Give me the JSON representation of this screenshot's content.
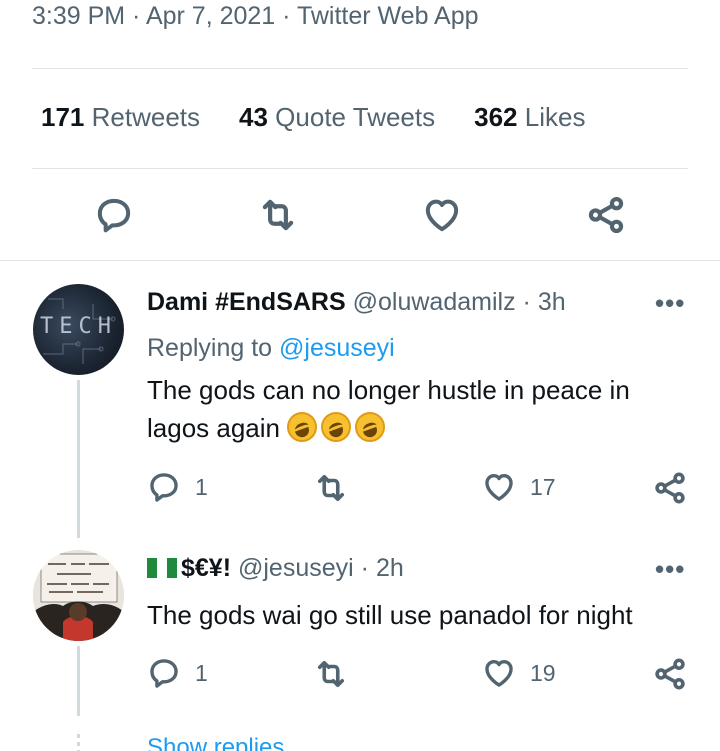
{
  "tweet": {
    "meta": "3:39 PM · Apr 7, 2021 · Twitter Web App",
    "stats": [
      {
        "count": "171",
        "label": "Retweets"
      },
      {
        "count": "43",
        "label": "Quote Tweets"
      },
      {
        "count": "362",
        "label": "Likes"
      }
    ],
    "actions": [
      "reply-icon",
      "retweet-icon",
      "like-icon",
      "share-icon"
    ]
  },
  "replies": [
    {
      "name": "Dami #EndSARS",
      "handle": "@oluwadamilz",
      "sep": "·",
      "time": "3h",
      "more": "•••",
      "replying_prefix": "Replying to",
      "replying_to": "@jesuseyi",
      "text": "The gods can no longer hustle in peace in lagos again",
      "emoji": "rolling-on-floor-laughing x3",
      "avatar_text": "TECH",
      "reply_count": "1",
      "retweet_count": "",
      "like_count": "17"
    },
    {
      "name": "$€¥!",
      "flag": "nigeria-flag",
      "handle": "@jesuseyi",
      "sep": "·",
      "time": "2h",
      "more": "•••",
      "text": "The gods wai go still use panadol for night",
      "reply_count": "1",
      "retweet_count": "",
      "like_count": "19"
    }
  ],
  "show_replies": "Show replies",
  "colors": {
    "text": "#0f1419",
    "muted": "#536471",
    "link": "#1d9bf0",
    "divider": "#e1e4e7",
    "thread": "#cfd9de"
  }
}
